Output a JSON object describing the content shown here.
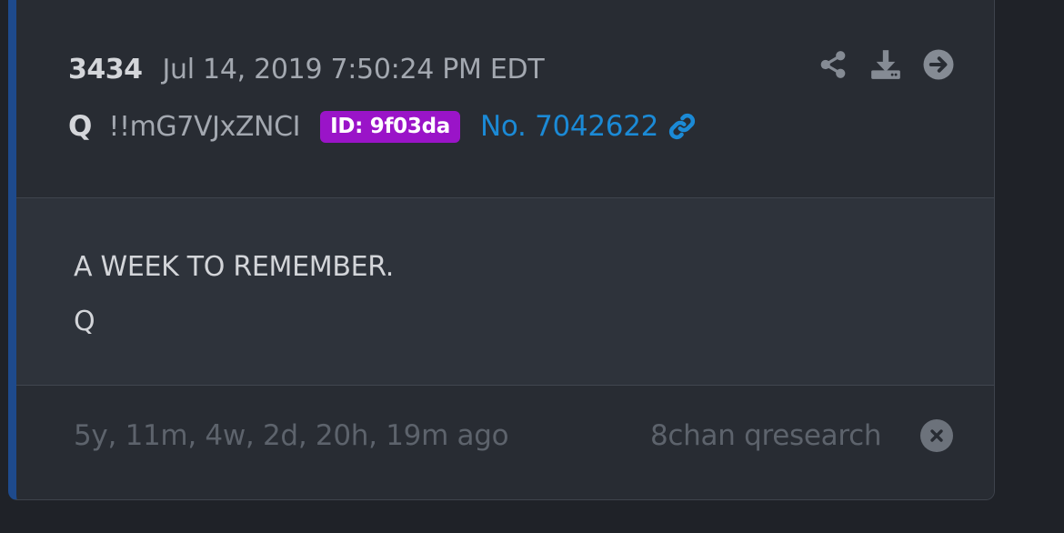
{
  "post": {
    "number": "3434",
    "date": "Jul 14, 2019 7:50:24 PM EDT",
    "author": "Q",
    "tripcode": "!!mG7VJxZNCI",
    "id_badge": "ID: 9f03da",
    "post_link": "No. 7042622",
    "message_lines": [
      "A WEEK TO REMEMBER.",
      "Q"
    ],
    "age": "5y, 11m, 4w, 2d, 20h, 19m ago",
    "source": "8chan qresearch"
  },
  "icons": {
    "share": "share-icon",
    "download": "download-icon",
    "navigate": "arrow-circle-right-icon",
    "link": "link-icon",
    "close": "close-circle-icon"
  },
  "colors": {
    "background": "#1f2228",
    "card": "#282c33",
    "message_area": "#2e333b",
    "accent_bar": "#1e4a8c",
    "id_badge": "#9a14c8",
    "link": "#1b8ad6",
    "muted_text": "#5d636c"
  }
}
